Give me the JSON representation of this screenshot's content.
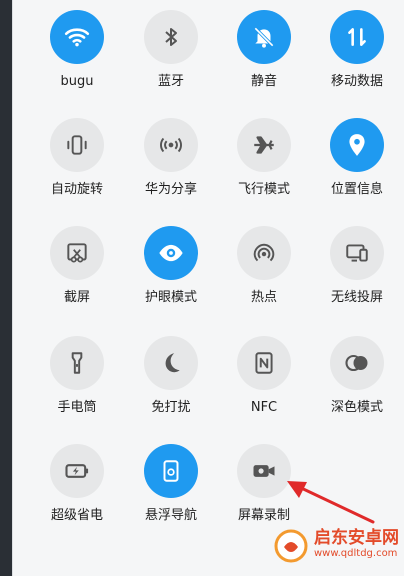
{
  "tiles": [
    {
      "id": "wifi",
      "label": "bugu",
      "active": true,
      "icon": "wifi-icon"
    },
    {
      "id": "bluetooth",
      "label": "蓝牙",
      "active": false,
      "icon": "bluetooth-icon"
    },
    {
      "id": "mute",
      "label": "静音",
      "active": true,
      "icon": "bell-mute-icon"
    },
    {
      "id": "mobile-data",
      "label": "移动数据",
      "active": true,
      "icon": "mobile-data-icon"
    },
    {
      "id": "auto-rotate",
      "label": "自动旋转",
      "active": false,
      "icon": "rotate-phone-icon"
    },
    {
      "id": "huawei-share",
      "label": "华为分享",
      "active": false,
      "icon": "share-wave-icon"
    },
    {
      "id": "airplane",
      "label": "飞行模式",
      "active": false,
      "icon": "airplane-icon"
    },
    {
      "id": "location",
      "label": "位置信息",
      "active": true,
      "icon": "location-pin-icon"
    },
    {
      "id": "screenshot",
      "label": "截屏",
      "active": false,
      "icon": "screenshot-scissors-icon"
    },
    {
      "id": "eye-care",
      "label": "护眼模式",
      "active": true,
      "icon": "eye-icon"
    },
    {
      "id": "hotspot",
      "label": "热点",
      "active": false,
      "icon": "hotspot-icon"
    },
    {
      "id": "wireless-projection",
      "label": "无线投屏",
      "active": false,
      "icon": "cast-screen-icon"
    },
    {
      "id": "flashlight",
      "label": "手电筒",
      "active": false,
      "icon": "flashlight-icon"
    },
    {
      "id": "do-not-disturb",
      "label": "免打扰",
      "active": false,
      "icon": "moon-icon"
    },
    {
      "id": "nfc",
      "label": "NFC",
      "active": false,
      "icon": "nfc-icon"
    },
    {
      "id": "dark-mode",
      "label": "深色模式",
      "active": false,
      "icon": "dark-mode-icon"
    },
    {
      "id": "super-power-saving",
      "label": "超级省电",
      "active": false,
      "icon": "battery-bolt-icon"
    },
    {
      "id": "floating-dock",
      "label": "悬浮导航",
      "active": true,
      "icon": "floating-dock-icon"
    },
    {
      "id": "screen-recording",
      "label": "屏幕录制",
      "active": false,
      "icon": "video-camera-icon"
    }
  ],
  "watermark": {
    "title": "启东安卓网",
    "url": "www.qdltdg.com"
  },
  "colors": {
    "active": "#1f9af0",
    "inactive": "#e6e7e8",
    "iconOn": "#ffffff",
    "iconOff": "#555555",
    "arrow": "#e02a2a"
  }
}
